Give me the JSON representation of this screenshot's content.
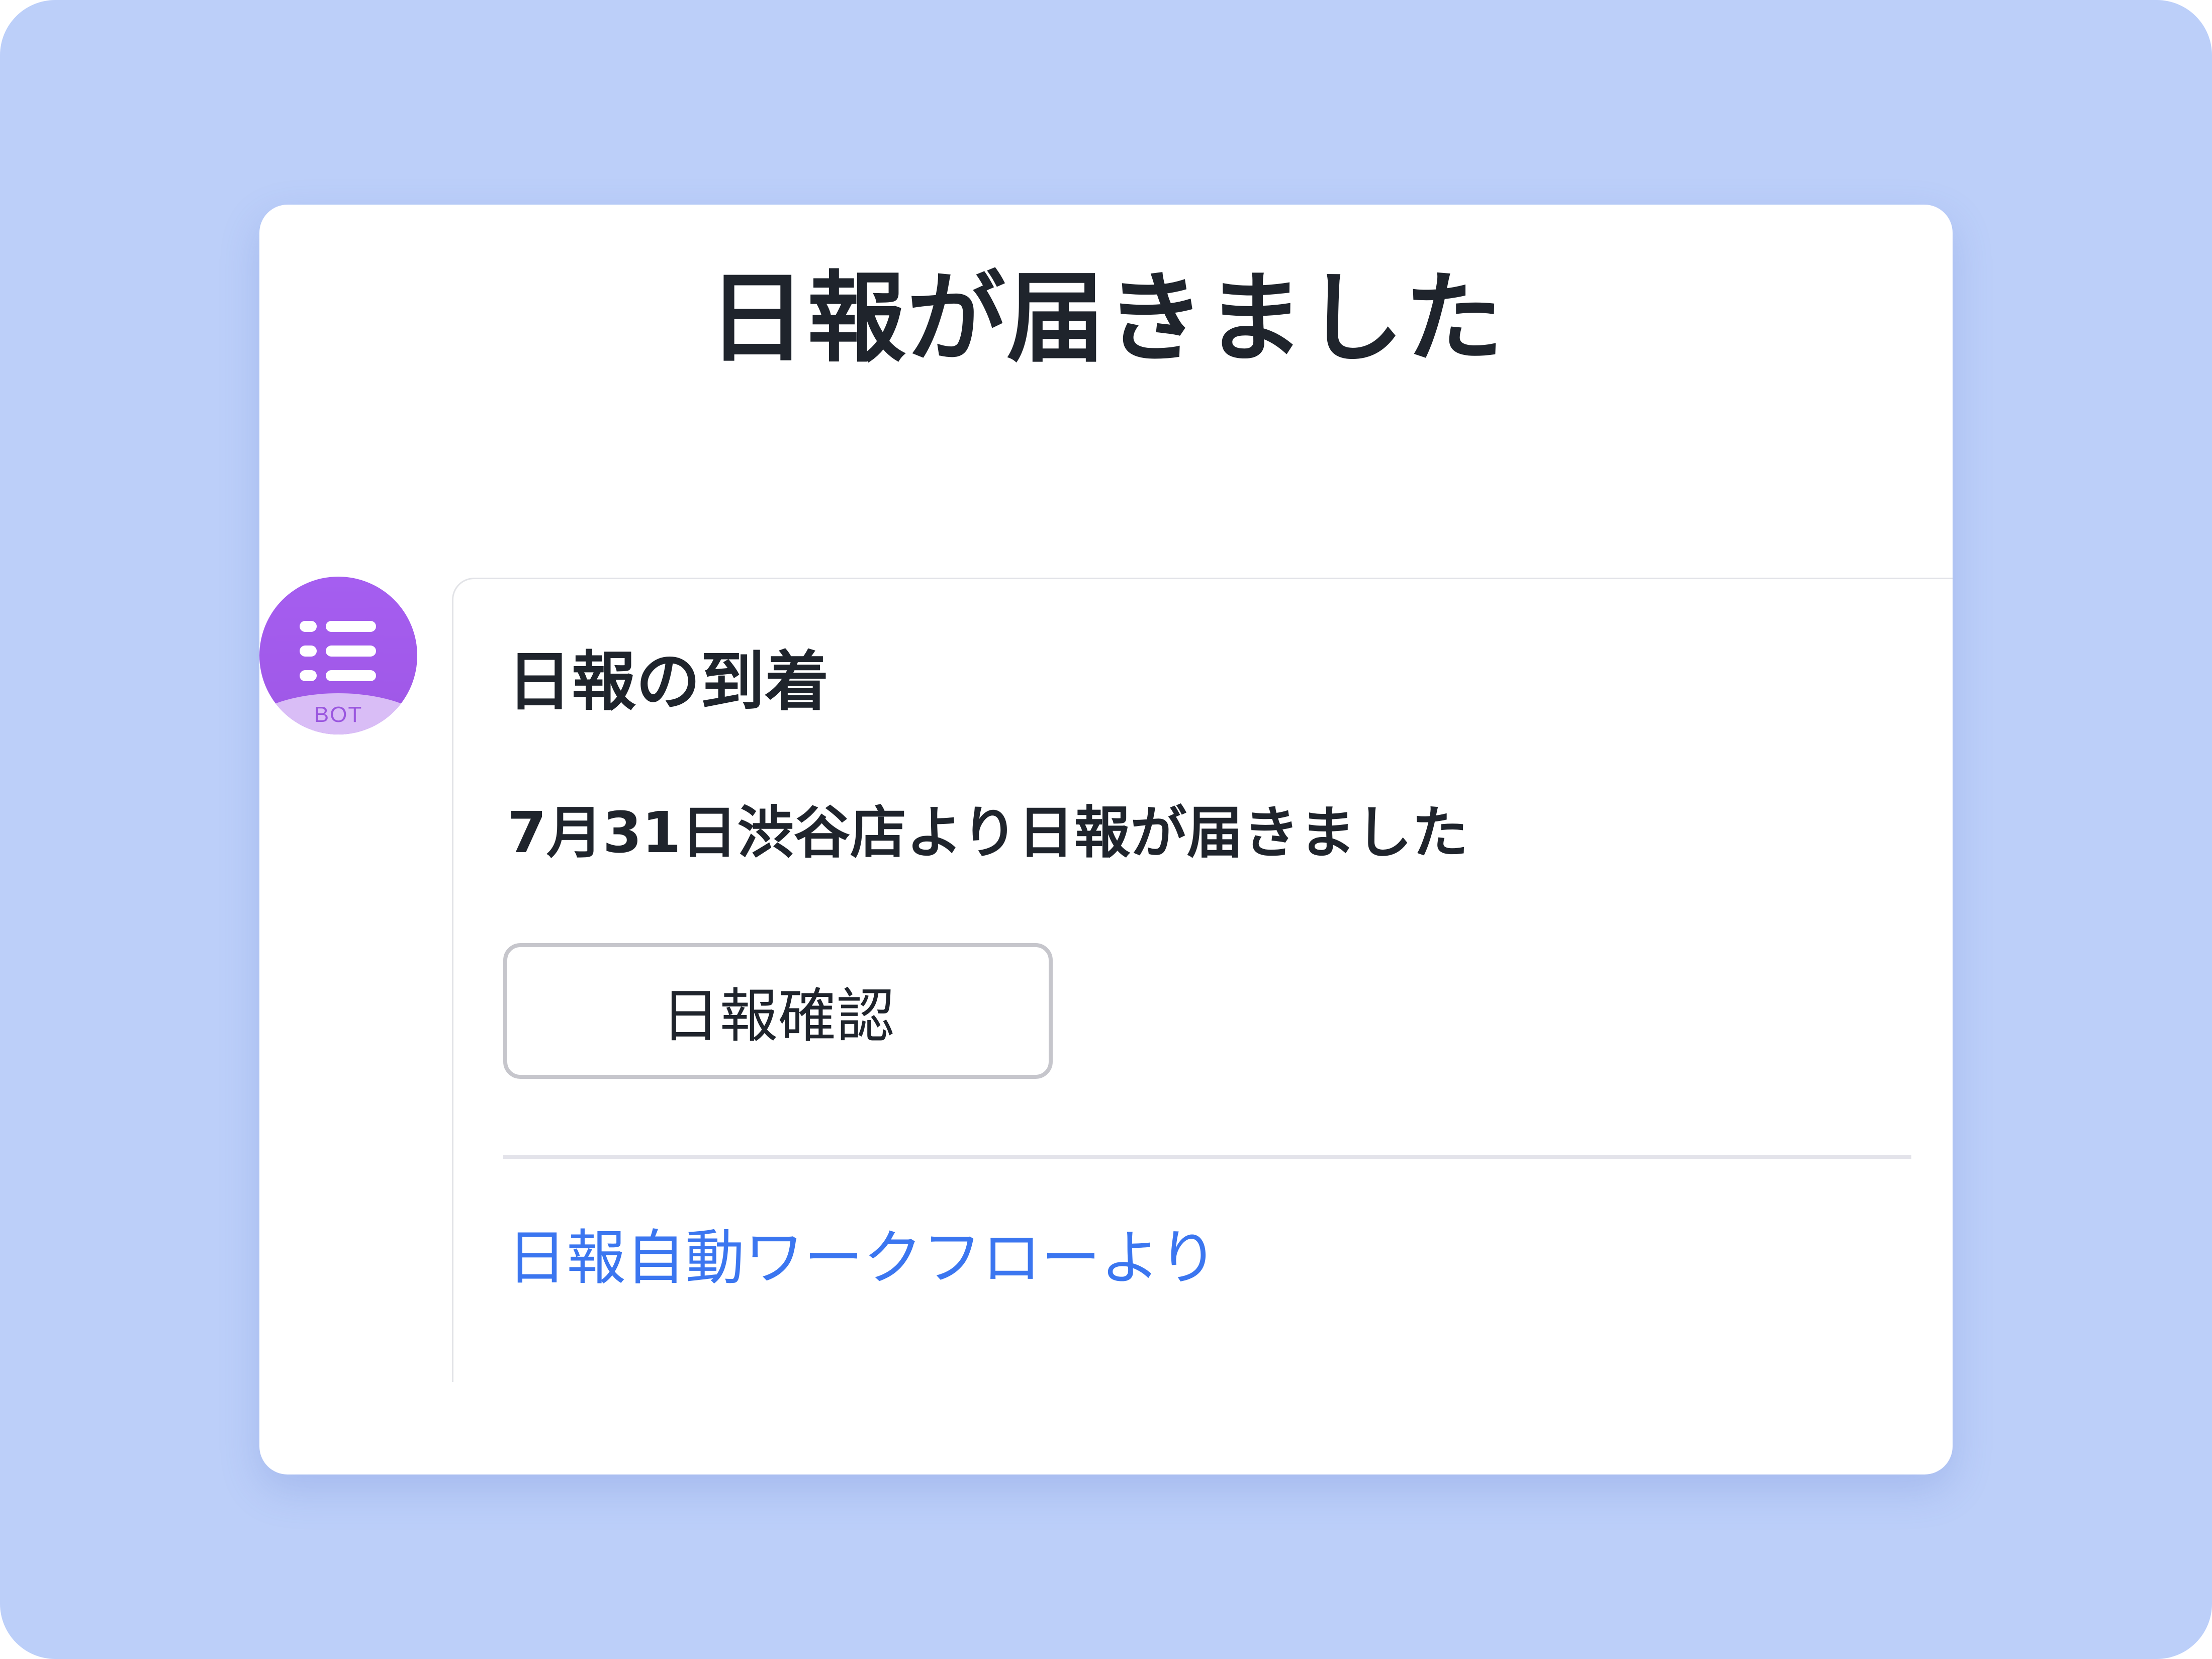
{
  "header": {
    "title": "日報が届きました"
  },
  "bot": {
    "icon": "list-icon",
    "badge": "BOT",
    "colors": {
      "avatar": "#a55ef0",
      "badge_band": "#d9bdf6"
    }
  },
  "card": {
    "title": "日報の到着",
    "message": "7月31日渋谷店より日報が届きました",
    "button_label": "日報確認",
    "footer_link": "日報自動ワークフローより"
  },
  "colors": {
    "background": "#bccff9",
    "text": "#1f242c",
    "link": "#3b76f0"
  }
}
